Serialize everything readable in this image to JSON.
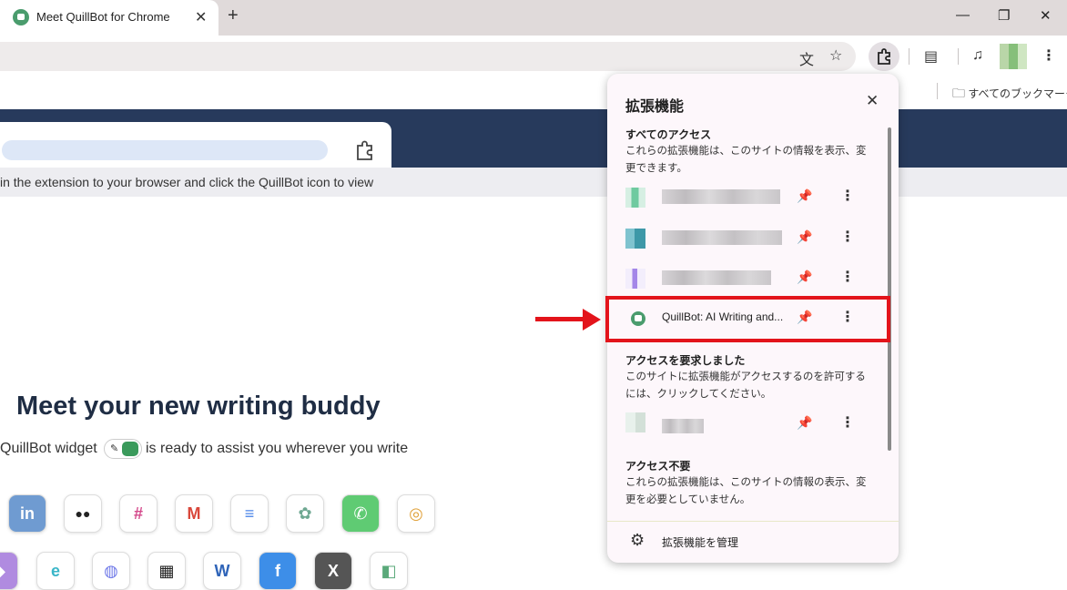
{
  "browser": {
    "tab_title": "Meet QuillBot for Chrome",
    "tab_close": "✕",
    "new_tab": "+",
    "window_minimize": "—",
    "window_restore": "❐",
    "window_close": "✕",
    "bookmarks_all": "すべてのブックマーク"
  },
  "page": {
    "hint_text": "in the extension to your browser and click the QuillBot icon to view",
    "headline": "Meet your new writing buddy",
    "subline_before": "QuillBot widget",
    "subline_after": "is ready to assist you wherever you write",
    "apps": [
      "in",
      "●●",
      "#",
      "M",
      "≡",
      "✿",
      "✆",
      "◎",
      "◆",
      "e",
      "◍",
      "▦",
      "W",
      "f",
      "X",
      "◧"
    ]
  },
  "popup": {
    "title": "拡張機能",
    "close": "✕",
    "section_full_access": {
      "heading": "すべてのアクセス",
      "description": "これらの拡張機能は、このサイトの情報を表示、変更できます。"
    },
    "section_requested": {
      "heading": "アクセスを要求しました",
      "description": "このサイトに拡張機能がアクセスするのを許可するには、クリックしてください。"
    },
    "section_no_access": {
      "heading": "アクセス不要",
      "description": "これらの拡張機能は、このサイトの情報の表示、変更を必要としていません。"
    },
    "quillbot_name": "QuillBot: AI Writing and...",
    "manage_label": "拡張機能を管理",
    "pin_glyph": "📌",
    "more_glyph": "⋮"
  },
  "colors": {
    "banner": "#273a5c",
    "annotation_red": "#e3141b",
    "quillbot_green": "#4a9c6d"
  }
}
